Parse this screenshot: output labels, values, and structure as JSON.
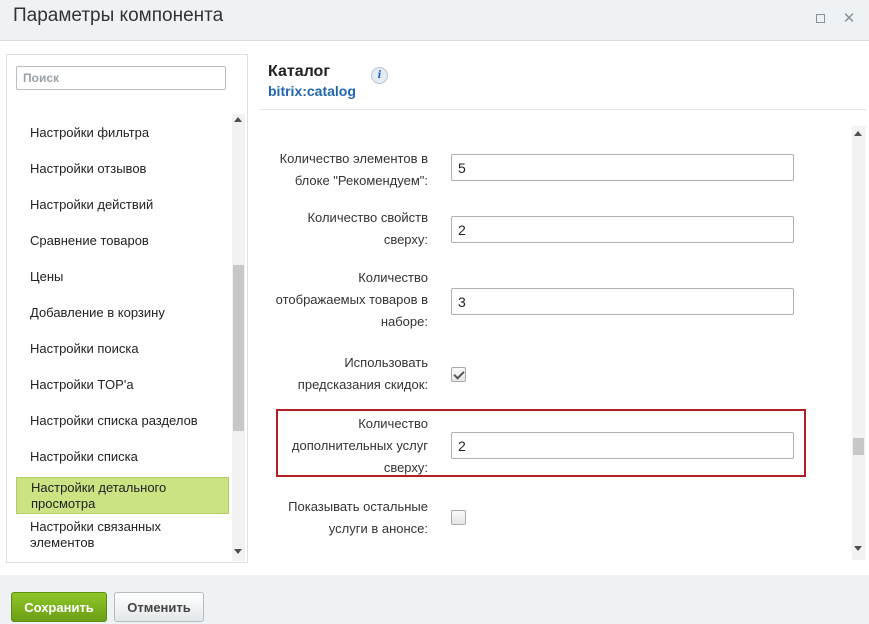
{
  "window": {
    "title": "Параметры компонента"
  },
  "sidebar": {
    "search_placeholder": "Поиск",
    "items": [
      {
        "label": "Настройки фильтра"
      },
      {
        "label": "Настройки отзывов"
      },
      {
        "label": "Настройки действий"
      },
      {
        "label": "Сравнение товаров"
      },
      {
        "label": "Цены"
      },
      {
        "label": "Добавление в корзину"
      },
      {
        "label": "Настройки поиска"
      },
      {
        "label": "Настройки TOP'а"
      },
      {
        "label": "Настройки списка разделов"
      },
      {
        "label": "Настройки списка"
      },
      {
        "label": "Настройки детального просмотра",
        "active": true
      },
      {
        "label": "Настройки связанных элементов"
      }
    ]
  },
  "component": {
    "title": "Каталог",
    "code": "bitrix:catalog",
    "info_icon": "info-icon"
  },
  "params": [
    {
      "label": "Количество элементов в блоке \"Рекомендуем\":",
      "value": "5",
      "type": "text"
    },
    {
      "label": "Количество свойств сверху:",
      "value": "2",
      "type": "text"
    },
    {
      "label": "Количество отображаемых товаров в наборе:",
      "value": "3",
      "type": "text"
    },
    {
      "label": "Использовать предсказания скидок:",
      "checked": true,
      "type": "checkbox"
    },
    {
      "label": "Количество дополнительных услуг сверху:",
      "value": "2",
      "type": "text",
      "highlighted": true
    },
    {
      "label": "Показывать остальные услуги в анонсе:",
      "checked": false,
      "type": "checkbox"
    }
  ],
  "footer": {
    "save_label": "Сохранить",
    "cancel_label": "Отменить"
  },
  "colors": {
    "highlight_border": "#b21f24",
    "save_button": "#7ab11f",
    "active_item": "#cbe382",
    "link_blue": "#2067b0"
  }
}
